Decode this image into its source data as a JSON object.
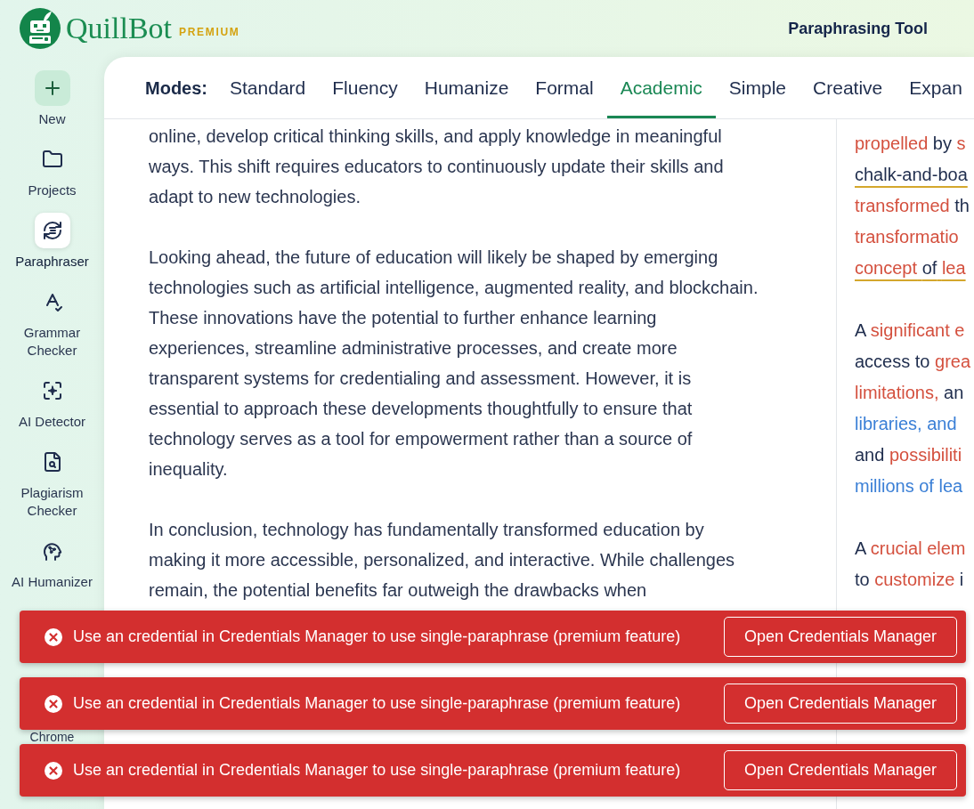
{
  "header": {
    "brand": "QuillBot",
    "tier": "PREMIUM",
    "title": "Paraphrasing Tool"
  },
  "sidebar": {
    "items": [
      {
        "label": "New",
        "kind": "create",
        "selected": false
      },
      {
        "label": "Projects",
        "kind": "tool",
        "selected": false
      },
      {
        "label": "Paraphraser",
        "kind": "tool",
        "selected": true
      },
      {
        "label": "Grammar Checker",
        "kind": "tool",
        "selected": false
      },
      {
        "label": "AI Detector",
        "kind": "tool",
        "selected": false
      },
      {
        "label": "Plagiarism Checker",
        "kind": "tool",
        "selected": false
      },
      {
        "label": "AI Humanizer",
        "kind": "tool",
        "selected": false
      },
      {
        "label": "Chrome",
        "kind": "extension",
        "selected": false
      }
    ]
  },
  "modes": {
    "label": "Modes:",
    "tabs": [
      {
        "label": "Standard",
        "selected": false
      },
      {
        "label": "Fluency",
        "selected": false
      },
      {
        "label": "Humanize",
        "selected": false
      },
      {
        "label": "Formal",
        "selected": false
      },
      {
        "label": "Academic",
        "selected": true
      },
      {
        "label": "Simple",
        "selected": false
      },
      {
        "label": "Creative",
        "selected": false
      },
      {
        "label": "Expan",
        "selected": false
      }
    ]
  },
  "input_text": {
    "paragraphs": [
      {
        "lines": [
          "online, develop critical thinking skills, and apply knowledge in meaningful",
          "ways. This shift requires educators to continuously update their skills and",
          "adapt to new technologies."
        ]
      },
      {
        "lines": [
          "Looking ahead, the future of education will likely be shaped by emerging",
          "technologies such as artificial intelligence, augmented reality, and blockchain.",
          "These innovations have the potential to further enhance learning",
          "experiences, streamline administrative processes, and create more",
          "transparent systems for credentialing and assessment. However, it is",
          "essential to approach these developments thoughtfully to ensure that",
          "technology serves as a tool for empowerment rather than a source of",
          "inequality."
        ]
      },
      {
        "lines": [
          "In conclusion, technology has fundamentally transformed education by",
          "making it more accessible, personalized, and interactive. While challenges",
          "remain, the potential benefits far outweigh the drawbacks when"
        ]
      }
    ]
  },
  "output_text": {
    "paragraphs": [
      {
        "lines": [
          {
            "underlined": false,
            "segments": [
              {
                "kind": "changed",
                "text": "propelled"
              },
              {
                "kind": "same",
                "text": "by"
              },
              {
                "kind": "changed",
                "text": "s"
              }
            ]
          },
          {
            "underlined": true,
            "segments": [
              {
                "kind": "same",
                "text": "chalk-and-boa"
              }
            ]
          },
          {
            "underlined": false,
            "segments": [
              {
                "kind": "changed",
                "text": "transformed"
              },
              {
                "kind": "same",
                "text": "th"
              }
            ]
          },
          {
            "underlined": false,
            "segments": [
              {
                "kind": "changed",
                "text": "transformatio"
              }
            ]
          },
          {
            "underlined": true,
            "segments": [
              {
                "kind": "changed",
                "text": "concept"
              },
              {
                "kind": "same",
                "text": "of"
              },
              {
                "kind": "changed",
                "text": "lea"
              }
            ]
          }
        ]
      },
      {
        "lines": [
          {
            "underlined": false,
            "segments": [
              {
                "kind": "same",
                "text": "A"
              },
              {
                "kind": "changed",
                "text": "significant e"
              }
            ]
          },
          {
            "underlined": false,
            "segments": [
              {
                "kind": "same",
                "text": "access to"
              },
              {
                "kind": "changed",
                "text": "grea"
              }
            ]
          },
          {
            "underlined": false,
            "segments": [
              {
                "kind": "changed",
                "text": "limitations,"
              },
              {
                "kind": "same",
                "text": "an"
              }
            ]
          },
          {
            "underlined": false,
            "segments": [
              {
                "kind": "structural",
                "text": "libraries, and"
              }
            ]
          },
          {
            "underlined": false,
            "segments": [
              {
                "kind": "same",
                "text": "and"
              },
              {
                "kind": "changed",
                "text": "possibiliti"
              }
            ]
          },
          {
            "underlined": false,
            "segments": [
              {
                "kind": "structural",
                "text": "millions of lea"
              }
            ]
          }
        ]
      },
      {
        "lines": [
          {
            "underlined": false,
            "segments": [
              {
                "kind": "same",
                "text": "A"
              },
              {
                "kind": "changed",
                "text": "crucial elem"
              }
            ]
          },
          {
            "underlined": false,
            "segments": [
              {
                "kind": "same",
                "text": "to"
              },
              {
                "kind": "changed",
                "text": "customize"
              },
              {
                "kind": "same",
                "text": "i"
              }
            ]
          }
        ]
      }
    ]
  },
  "toasts": [
    {
      "message": "Use an credential in Credentials Manager to use single-paraphrase (premium feature)",
      "action": "Open Credentials Manager"
    },
    {
      "message": "Use an credential in Credentials Manager to use single-paraphrase (premium feature)",
      "action": "Open Credentials Manager"
    },
    {
      "message": "Use an credential in Credentials Manager to use single-paraphrase (premium feature)",
      "action": "Open Credentials Manager"
    }
  ]
}
